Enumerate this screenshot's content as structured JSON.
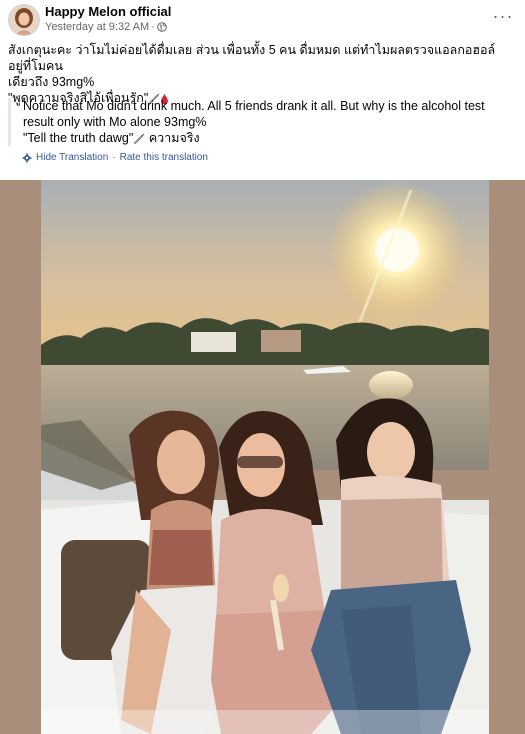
{
  "post": {
    "page_name": "Happy Melon official",
    "timestamp": "Yesterday at 9:32 AM",
    "separator": "·",
    "privacy_icon": "globe-icon",
    "more_icon": "more-horizontal-icon",
    "more_label": "···",
    "text_line1": "สังเกตุนะคะ ว่าโมไม่ค่อยได้ดื่มเลย ส่วน เพื่อนทั้ง 5 คน ดื่มหมด  แต่ทำไมผลตรวจแอลกอฮอล์ อยู่ที่โมคน",
    "text_line2": "เดียวถึง 93mg%",
    "text_line3": "\"พูดความจริงสิไอ้เพื่อนรัก\"",
    "translated_line1": "Notice that Mo didn't drink much. All 5 friends drank it all. But why is the alcohol test",
    "translated_line2": "result only with Mo alone 93mg%",
    "translated_line3": "\"Tell the truth dawg\"",
    "translated_suffix": "ความจริง",
    "hide_translation": "Hide Translation",
    "link_separator": "·",
    "rate_translation": "Rate this translation",
    "photo_alt": "Three women sitting on a boat at sunset on a river"
  },
  "colors": {
    "link": "#385898",
    "meta": "#65676b",
    "text": "#050505",
    "photo_frame": "#a88e7b"
  }
}
